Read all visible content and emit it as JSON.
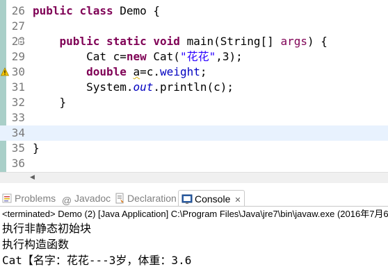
{
  "editor": {
    "lines": [
      {
        "num": "26",
        "parts": [
          {
            "t": "public",
            "c": "kw"
          },
          {
            "t": " "
          },
          {
            "t": "class",
            "c": "kw"
          },
          {
            "t": " Demo {"
          }
        ]
      },
      {
        "num": "27",
        "parts": []
      },
      {
        "num": "28",
        "parts": [
          {
            "t": "    "
          },
          {
            "t": "public",
            "c": "kw"
          },
          {
            "t": " "
          },
          {
            "t": "static",
            "c": "kw"
          },
          {
            "t": " "
          },
          {
            "t": "void",
            "c": "kw"
          },
          {
            "t": " main(String[] "
          },
          {
            "t": "args",
            "c": "kw2"
          },
          {
            "t": ") {"
          }
        ]
      },
      {
        "num": "29",
        "parts": [
          {
            "t": "        Cat c="
          },
          {
            "t": "new",
            "c": "kw"
          },
          {
            "t": " Cat("
          },
          {
            "t": "\"花花\"",
            "c": "str"
          },
          {
            "t": ",3);"
          }
        ]
      },
      {
        "num": "30",
        "parts": [
          {
            "t": "        "
          },
          {
            "t": "double",
            "c": "kw"
          },
          {
            "t": " "
          },
          {
            "t": "a",
            "c": "warn"
          },
          {
            "t": "=c."
          },
          {
            "t": "weight",
            "c": "fld"
          },
          {
            "t": ";"
          }
        ]
      },
      {
        "num": "31",
        "parts": [
          {
            "t": "        System."
          },
          {
            "t": "out",
            "c": "sfld"
          },
          {
            "t": ".println(c);"
          }
        ]
      },
      {
        "num": "32",
        "parts": [
          {
            "t": "    }"
          }
        ]
      },
      {
        "num": "33",
        "parts": []
      },
      {
        "num": "34",
        "parts": []
      },
      {
        "num": "35",
        "parts": [
          {
            "t": "}"
          }
        ]
      },
      {
        "num": "36",
        "parts": []
      }
    ],
    "current_line": "34",
    "fold_line": "28",
    "warning_line": "30"
  },
  "tabs": {
    "problems": "Problems",
    "javadoc": "Javadoc",
    "declaration": "Declaration",
    "console": "Console"
  },
  "console": {
    "header": "<terminated> Demo (2) [Java Application] C:\\Program Files\\Java\\jre7\\bin\\javaw.exe (2016年7月6",
    "output": [
      "执行非静态初始块",
      "执行构造函数",
      "Cat【名字：花花---3岁，体重：3.6"
    ]
  },
  "colors": {
    "keyword": "#7f0055",
    "string": "#2a00ff",
    "field": "#0000c0",
    "current_line": "#e8f2fe",
    "marker_bar": "#a9cfc8"
  }
}
